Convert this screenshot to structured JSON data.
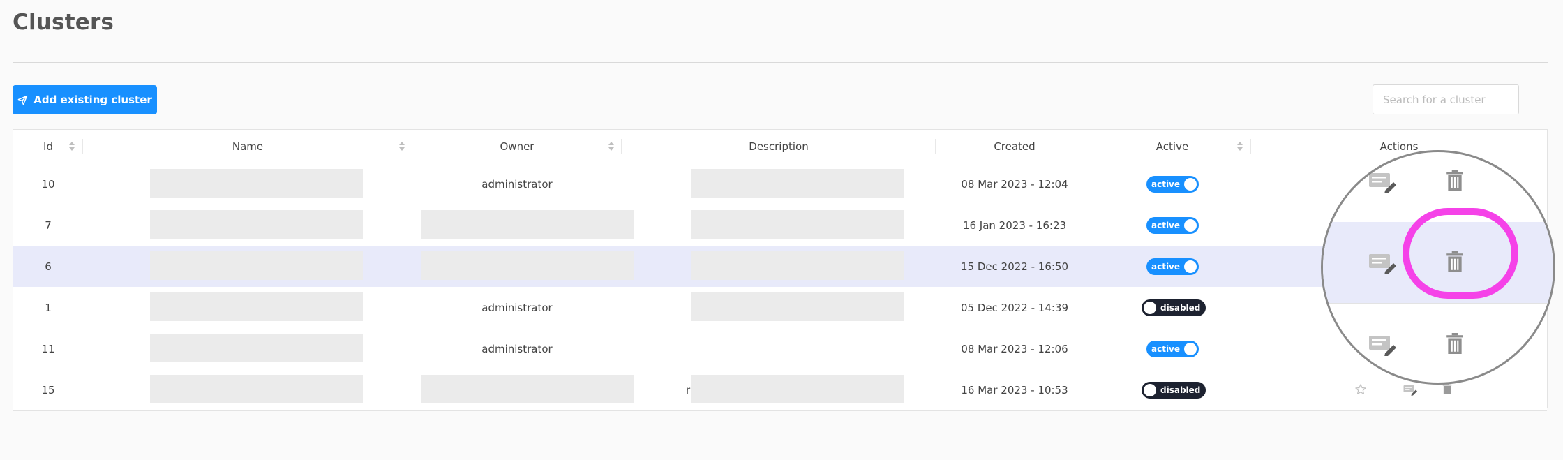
{
  "page": {
    "title": "Clusters"
  },
  "toolbar": {
    "add_label": "Add existing cluster"
  },
  "search": {
    "placeholder": "Search for a cluster",
    "value": ""
  },
  "table": {
    "columns": {
      "id": "Id",
      "name": "Name",
      "owner": "Owner",
      "description": "Description",
      "created": "Created",
      "active": "Active",
      "actions": "Actions"
    },
    "rows": [
      {
        "id": "10",
        "owner": "administrator",
        "created": "08 Mar 2023 - 12:04",
        "status": "active"
      },
      {
        "id": "7",
        "owner": "",
        "created": "16 Jan 2023 - 16:23",
        "status": "active"
      },
      {
        "id": "6",
        "owner": "",
        "created": "15 Dec 2022 - 16:50",
        "status": "active",
        "selected": true
      },
      {
        "id": "1",
        "owner": "administrator",
        "created": "05 Dec 2022 - 14:39",
        "status": "disabled"
      },
      {
        "id": "11",
        "owner": "administrator",
        "created": "08 Mar 2023 - 12:06",
        "status": "active"
      },
      {
        "id": "15",
        "owner": "",
        "description_fragment": "r",
        "created": "16 Mar 2023 - 10:53",
        "status": "disabled"
      }
    ]
  },
  "icons": {
    "add": "send-icon",
    "edit": "edit-icon",
    "delete": "trash-icon",
    "favorite": "star-icon",
    "sort": "sort-icon"
  },
  "colors": {
    "primary": "#1890ff",
    "toggle_off": "#1d2230",
    "selected_row": "#e8eafa",
    "highlight": "#f542e8",
    "redaction": "#ebebeb"
  }
}
